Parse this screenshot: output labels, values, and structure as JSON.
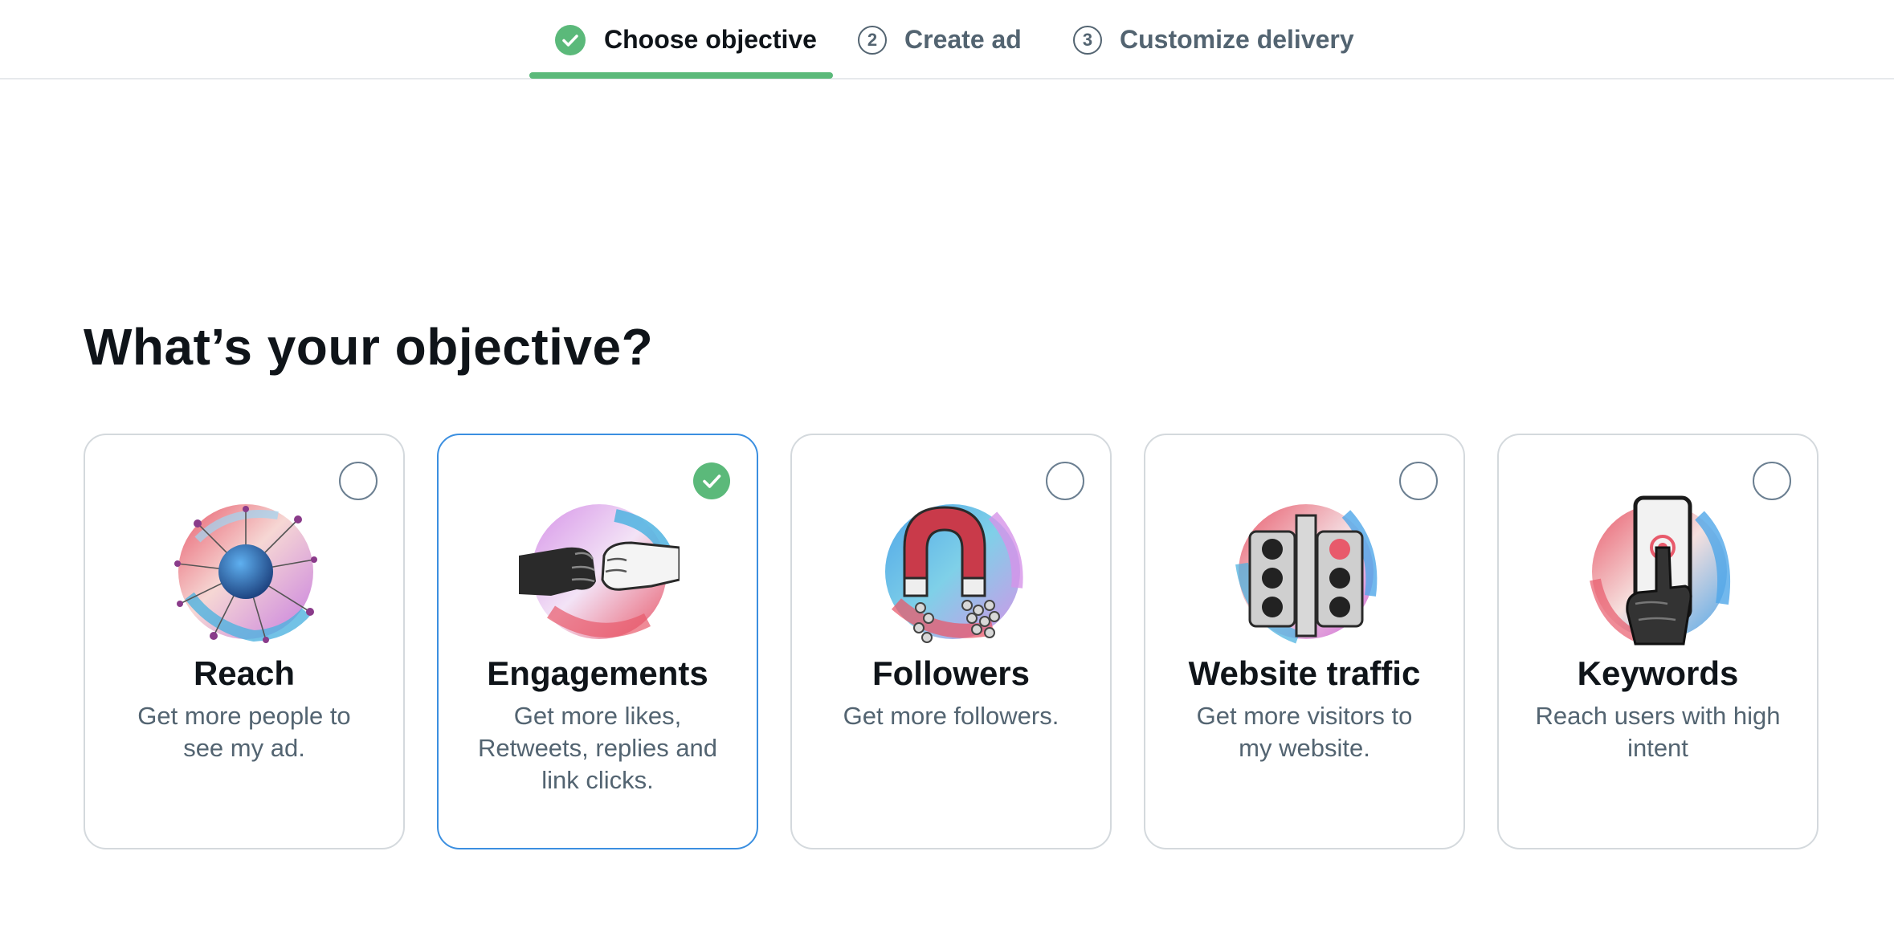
{
  "stepper": {
    "steps": [
      {
        "label": "Choose objective",
        "status": "completed"
      },
      {
        "label": "Create ad",
        "number": "2",
        "status": "pending"
      },
      {
        "label": "Customize delivery",
        "number": "3",
        "status": "pending"
      }
    ]
  },
  "heading": "What’s your objective?",
  "objectives": [
    {
      "title": "Reach",
      "description": "Get more people to see my ad.",
      "selected": false,
      "icon": "network-globe-icon"
    },
    {
      "title": "Engagements",
      "description": "Get more likes, Retweets, replies and link clicks.",
      "selected": true,
      "icon": "fist-bump-icon"
    },
    {
      "title": "Followers",
      "description": "Get more followers.",
      "selected": false,
      "icon": "magnet-icon"
    },
    {
      "title": "Website traffic",
      "description": "Get more visitors to my website.",
      "selected": false,
      "icon": "traffic-light-icon"
    },
    {
      "title": "Keywords",
      "description": "Reach users with high intent",
      "selected": false,
      "icon": "phone-tap-icon"
    }
  ],
  "colors": {
    "accent_green": "#5bb97a",
    "selected_border": "#3b8fe0",
    "muted_text": "#536471"
  }
}
